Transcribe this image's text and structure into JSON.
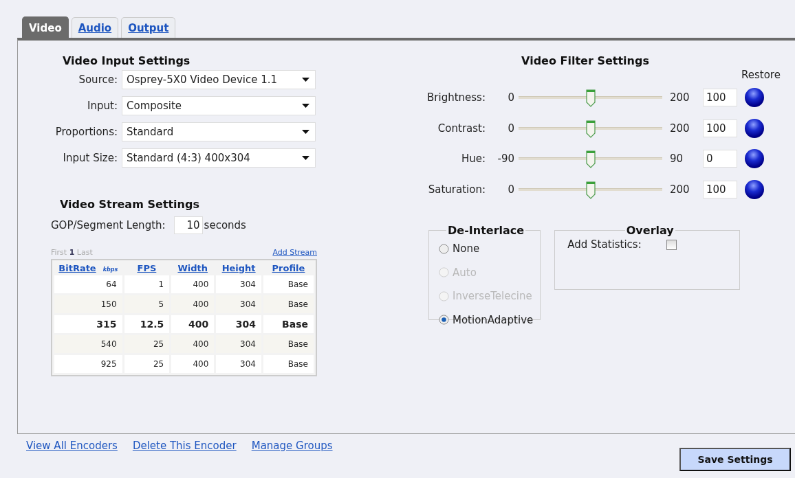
{
  "tabs": [
    {
      "label": "Video",
      "selected": true
    },
    {
      "label": "Audio",
      "selected": false
    },
    {
      "label": "Output",
      "selected": false
    }
  ],
  "video_input_settings": {
    "title": "Video Input Settings",
    "fields": [
      {
        "label": "Source:",
        "value": "Osprey-5X0 Video Device 1.1"
      },
      {
        "label": "Input:",
        "value": "Composite"
      },
      {
        "label": "Proportions:",
        "value": "Standard"
      },
      {
        "label": "Input Size:",
        "value": "Standard (4:3) 400x304"
      }
    ]
  },
  "video_stream_settings": {
    "title": "Video Stream Settings",
    "gop_label": "GOP/Segment Length:",
    "gop_value": "10",
    "gop_unit": "seconds",
    "pager": {
      "first": "First",
      "page": "1",
      "last": "Last"
    },
    "add_stream": "Add Stream",
    "table": {
      "columns": [
        {
          "label": "BitRate",
          "unit": "kbps"
        },
        {
          "label": "FPS"
        },
        {
          "label": "Width"
        },
        {
          "label": "Height"
        },
        {
          "label": "Profile"
        }
      ],
      "rows": [
        {
          "selected": false,
          "cells": [
            "64",
            "1",
            "400",
            "304",
            "Base"
          ]
        },
        {
          "selected": false,
          "cells": [
            "150",
            "5",
            "400",
            "304",
            "Base"
          ]
        },
        {
          "selected": true,
          "cells": [
            "315",
            "12.5",
            "400",
            "304",
            "Base"
          ]
        },
        {
          "selected": false,
          "cells": [
            "540",
            "25",
            "400",
            "304",
            "Base"
          ]
        },
        {
          "selected": false,
          "cells": [
            "925",
            "25",
            "400",
            "304",
            "Base"
          ]
        }
      ]
    }
  },
  "video_filter_settings": {
    "title": "Video Filter Settings",
    "restore_label": "Restore",
    "sliders": [
      {
        "label": "Brightness:",
        "min": "0",
        "max": "200",
        "level": 0.5,
        "value": "100"
      },
      {
        "label": "Contrast:",
        "min": "0",
        "max": "200",
        "level": 0.5,
        "value": "100"
      },
      {
        "label": "Hue:",
        "min": "-90",
        "max": "90",
        "level": 0.5,
        "value": "0"
      },
      {
        "label": "Saturation:",
        "min": "0",
        "max": "200",
        "level": 0.5,
        "value": "100"
      }
    ]
  },
  "de_interlace": {
    "title": "De-Interlace",
    "options": [
      {
        "label": "None",
        "selected": false,
        "disabled": false
      },
      {
        "label": "Auto",
        "selected": false,
        "disabled": true
      },
      {
        "label": "InverseTelecine",
        "selected": false,
        "disabled": true
      },
      {
        "label": "MotionAdaptive",
        "selected": true,
        "disabled": false
      }
    ]
  },
  "overlay": {
    "title": "Overlay",
    "add_statistics": {
      "label": "Add Statistics:",
      "checked": false
    }
  },
  "footer_links": [
    "View All Encoders",
    "Delete This Encoder",
    "Manage Groups"
  ],
  "save_button": "Save Settings"
}
